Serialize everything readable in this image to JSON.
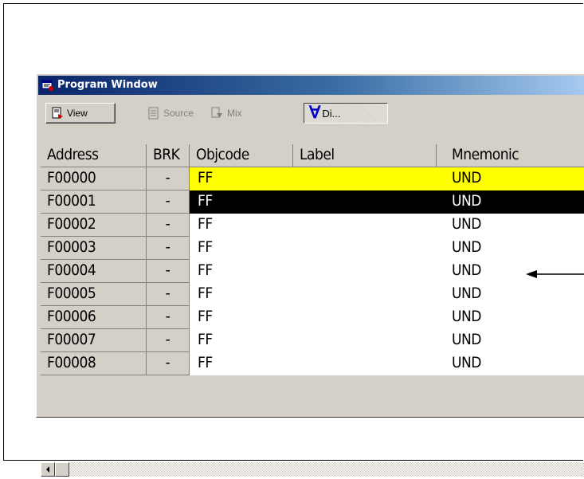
{
  "window": {
    "title": "Program Window",
    "icon": "program-window-icon",
    "title_gradient": [
      "#0a246a",
      "#a6caf0"
    ]
  },
  "toolbar": {
    "view_label": "View",
    "source_label": "Source",
    "mix_label": "Mix",
    "disasm_label": "Di..."
  },
  "columns": [
    "Address",
    "BRK",
    "Objcode",
    "Label",
    "Mnemonic"
  ],
  "rows": [
    {
      "address": "F00000",
      "brk": "-",
      "objcode": "FF",
      "label": "",
      "mnemonic": "UND",
      "highlight": "yellow"
    },
    {
      "address": "F00001",
      "brk": "-",
      "objcode": "FF",
      "label": "",
      "mnemonic": "UND",
      "highlight": "black"
    },
    {
      "address": "F00002",
      "brk": "-",
      "objcode": "FF",
      "label": "",
      "mnemonic": "UND",
      "highlight": "none"
    },
    {
      "address": "F00003",
      "brk": "-",
      "objcode": "FF",
      "label": "",
      "mnemonic": "UND",
      "highlight": "none"
    },
    {
      "address": "F00004",
      "brk": "-",
      "objcode": "FF",
      "label": "",
      "mnemonic": "UND",
      "highlight": "none"
    },
    {
      "address": "F00005",
      "brk": "-",
      "objcode": "FF",
      "label": "",
      "mnemonic": "UND",
      "highlight": "none"
    },
    {
      "address": "F00006",
      "brk": "-",
      "objcode": "FF",
      "label": "",
      "mnemonic": "UND",
      "highlight": "none"
    },
    {
      "address": "F00007",
      "brk": "-",
      "objcode": "FF",
      "label": "",
      "mnemonic": "UND",
      "highlight": "none"
    },
    {
      "address": "F00008",
      "brk": "-",
      "objcode": "FF",
      "label": "",
      "mnemonic": "UND",
      "highlight": "none"
    }
  ],
  "colors": {
    "pc_line": "#ffff00",
    "cursor_line": "#000000",
    "face": "#d4d0c8"
  }
}
